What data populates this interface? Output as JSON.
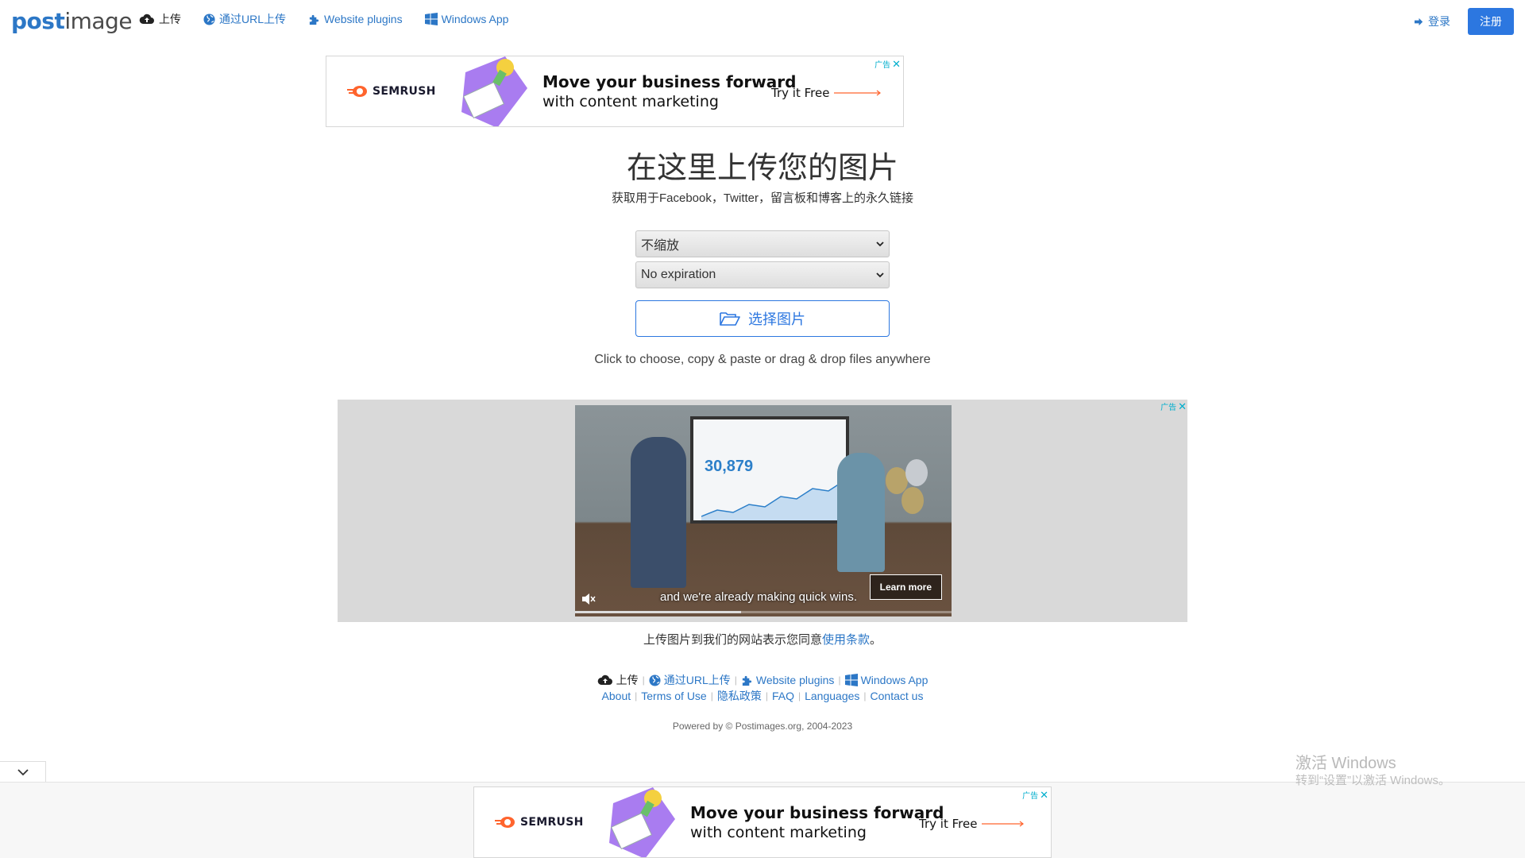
{
  "logo": {
    "post": "post",
    "image": "image"
  },
  "nav": {
    "upload": "上传",
    "url_upload": "通过URL上传",
    "plugins": "Website plugins",
    "windows_app": "Windows App",
    "login": "登录",
    "register": "注册"
  },
  "ad_top": {
    "brand": "SEMRUSH",
    "headline": "Move your business forward",
    "subline": "with content marketing",
    "cta": "Try it Free",
    "choices_label": "广告"
  },
  "main": {
    "title": "在这里上传您的图片",
    "subtitle": "获取用于Facebook，Twitter，留言板和博客上的永久链接",
    "resize_select": "不缩放",
    "expire_select": "No expiration",
    "choose_button": "选择图片",
    "hint": "Click to choose, copy & paste or drag & drop files anywhere"
  },
  "video_ad": {
    "stat": "30,879",
    "caption": "and we're already making quick wins.",
    "learn_more": "Learn more",
    "choices_label": "广告",
    "progress": 0.44
  },
  "terms": {
    "prefix": "上传图片到我们的网站表示您同意",
    "link": "使用条款",
    "suffix": "。"
  },
  "footer": {
    "upload": "上传",
    "url_upload": "通过URL上传",
    "plugins": "Website plugins",
    "windows_app": "Windows App",
    "about": "About",
    "terms_of_use": "Terms of Use",
    "privacy": "隐私政策",
    "faq": "FAQ",
    "languages": "Languages",
    "contact": "Contact us",
    "powered": "Powered by © Postimages.org, 2004-2023"
  },
  "ad_bottom": {
    "brand": "SEMRUSH",
    "headline": "Move your business forward",
    "subline": "with content marketing",
    "cta": "Try it Free",
    "choices_label": "广告"
  },
  "watermark": {
    "line1": "激活 Windows",
    "line2": "转到“设置”以激活 Windows。"
  },
  "colors": {
    "link": "#2c77c6",
    "primary": "#2c77e0",
    "ad_choices": "#00aecd",
    "semrush_orange": "#ff642d"
  }
}
